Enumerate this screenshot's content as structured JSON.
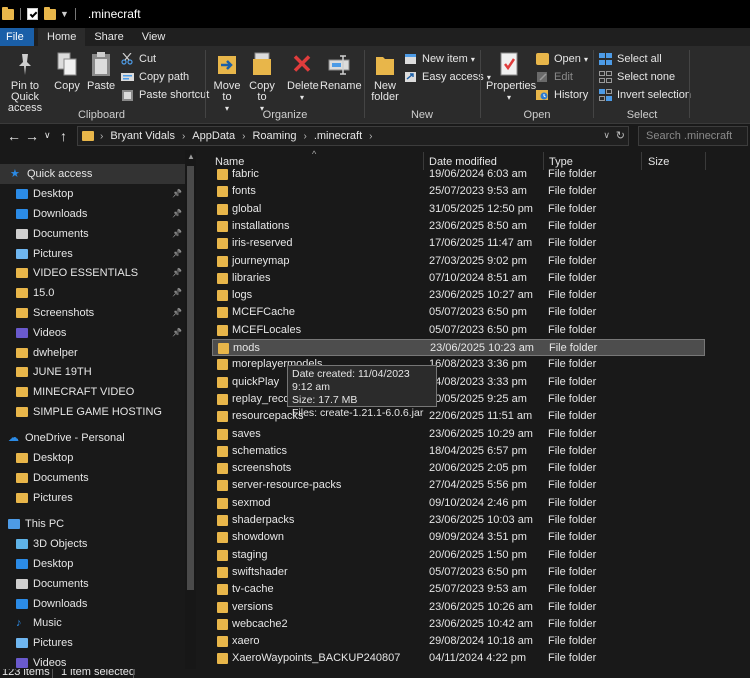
{
  "titlebar": {
    "title": ".minecraft"
  },
  "tabs": [
    {
      "label": "File"
    },
    {
      "label": "Home"
    },
    {
      "label": "Share"
    },
    {
      "label": "View"
    }
  ],
  "ribbon": {
    "clipboard": {
      "label": "Clipboard",
      "pin": "Pin to Quick access",
      "copy": "Copy",
      "paste": "Paste",
      "cut": "Cut",
      "copy_path": "Copy path",
      "paste_shortcut": "Paste shortcut"
    },
    "organize": {
      "label": "Organize",
      "move_to": "Move to",
      "copy_to": "Copy to",
      "delete": "Delete",
      "rename": "Rename"
    },
    "new": {
      "label": "New",
      "new_folder": "New folder",
      "new_item": "New item",
      "easy_access": "Easy access"
    },
    "open": {
      "label": "Open",
      "properties": "Properties",
      "open": "Open",
      "edit": "Edit",
      "history": "History"
    },
    "select": {
      "label": "Select",
      "select_all": "Select all",
      "select_none": "Select none",
      "invert": "Invert selection"
    }
  },
  "address": {
    "crumbs": [
      "Bryant Vidals",
      "AppData",
      "Roaming",
      ".minecraft"
    ],
    "search_placeholder": "Search .minecraft"
  },
  "sidebar": {
    "items": [
      {
        "label": "Quick access",
        "icon": "star-icon",
        "pinned": false
      },
      {
        "label": "Desktop",
        "icon": "desktop-icon",
        "pinned": true
      },
      {
        "label": "Downloads",
        "icon": "download-icon",
        "pinned": true
      },
      {
        "label": "Documents",
        "icon": "documents-icon",
        "pinned": true
      },
      {
        "label": "Pictures",
        "icon": "pictures-icon",
        "pinned": true
      },
      {
        "label": "VIDEO ESSENTIALS",
        "icon": "folder-icon",
        "pinned": true
      },
      {
        "label": "15.0",
        "icon": "folder-icon",
        "pinned": true
      },
      {
        "label": "Screenshots",
        "icon": "folder-icon",
        "pinned": true
      },
      {
        "label": "Videos",
        "icon": "videos-icon",
        "pinned": true
      },
      {
        "label": "dwhelper",
        "icon": "folder-icon",
        "pinned": false
      },
      {
        "label": "JUNE 19TH",
        "icon": "folder-icon",
        "pinned": false
      },
      {
        "label": "MINECRAFT VIDEO",
        "icon": "folder-icon",
        "pinned": false
      },
      {
        "label": "SIMPLE GAME HOSTING",
        "icon": "folder-icon",
        "pinned": false
      },
      {
        "label": "OneDrive - Personal",
        "icon": "cloud-icon",
        "pinned": false
      },
      {
        "label": "Desktop",
        "icon": "folder-icon",
        "pinned": false
      },
      {
        "label": "Documents",
        "icon": "folder-icon",
        "pinned": false
      },
      {
        "label": "Pictures",
        "icon": "folder-icon",
        "pinned": false
      },
      {
        "label": "This PC",
        "icon": "computer-icon",
        "pinned": false
      },
      {
        "label": "3D Objects",
        "icon": "3d-objects-icon",
        "pinned": false
      },
      {
        "label": "Desktop",
        "icon": "desktop-icon",
        "pinned": false
      },
      {
        "label": "Documents",
        "icon": "documents-icon",
        "pinned": false
      },
      {
        "label": "Downloads",
        "icon": "download-icon",
        "pinned": false
      },
      {
        "label": "Music",
        "icon": "music-icon",
        "pinned": false
      },
      {
        "label": "Pictures",
        "icon": "pictures-icon",
        "pinned": false
      },
      {
        "label": "Videos",
        "icon": "videos-icon",
        "pinned": false
      }
    ]
  },
  "columns": {
    "name": "Name",
    "date": "Date modified",
    "type": "Type",
    "size": "Size"
  },
  "files": [
    {
      "name": "fabric",
      "date": "19/06/2024 6:03 am",
      "type": "File folder"
    },
    {
      "name": "fonts",
      "date": "25/07/2023 9:53 am",
      "type": "File folder"
    },
    {
      "name": "global",
      "date": "31/05/2025 12:50 pm",
      "type": "File folder"
    },
    {
      "name": "installations",
      "date": "23/06/2025 8:50 am",
      "type": "File folder"
    },
    {
      "name": "iris-reserved",
      "date": "17/06/2025 11:47 am",
      "type": "File folder"
    },
    {
      "name": "journeymap",
      "date": "27/03/2025 9:02 pm",
      "type": "File folder"
    },
    {
      "name": "libraries",
      "date": "07/10/2024 8:51 am",
      "type": "File folder"
    },
    {
      "name": "logs",
      "date": "23/06/2025 10:27 am",
      "type": "File folder"
    },
    {
      "name": "MCEFCache",
      "date": "05/07/2023 6:50 pm",
      "type": "File folder"
    },
    {
      "name": "MCEFLocales",
      "date": "05/07/2023 6:50 pm",
      "type": "File folder"
    },
    {
      "name": "mods",
      "date": "23/06/2025 10:23 am",
      "type": "File folder"
    },
    {
      "name": "moreplayermodels",
      "date": "16/08/2023 3:36 pm",
      "type": "File folder"
    },
    {
      "name": "quickPlay",
      "date": "14/08/2023 3:33 pm",
      "type": "File folder"
    },
    {
      "name": "replay_recordings",
      "date": "10/05/2025 9:25 am",
      "type": "File folder"
    },
    {
      "name": "resourcepacks",
      "date": "22/06/2025 11:51 am",
      "type": "File folder"
    },
    {
      "name": "saves",
      "date": "23/06/2025 10:29 am",
      "type": "File folder"
    },
    {
      "name": "schematics",
      "date": "18/04/2025 6:57 pm",
      "type": "File folder"
    },
    {
      "name": "screenshots",
      "date": "20/06/2025 2:05 pm",
      "type": "File folder"
    },
    {
      "name": "server-resource-packs",
      "date": "27/04/2025 5:56 pm",
      "type": "File folder"
    },
    {
      "name": "sexmod",
      "date": "09/10/2024 2:46 pm",
      "type": "File folder"
    },
    {
      "name": "shaderpacks",
      "date": "23/06/2025 10:03 am",
      "type": "File folder"
    },
    {
      "name": "showdown",
      "date": "09/09/2024 3:51 pm",
      "type": "File folder"
    },
    {
      "name": "staging",
      "date": "20/06/2025 1:50 pm",
      "type": "File folder"
    },
    {
      "name": "swiftshader",
      "date": "05/07/2023 6:50 pm",
      "type": "File folder"
    },
    {
      "name": "tv-cache",
      "date": "25/07/2023 9:53 am",
      "type": "File folder"
    },
    {
      "name": "versions",
      "date": "23/06/2025 10:26 am",
      "type": "File folder"
    },
    {
      "name": "webcache2",
      "date": "23/06/2025 10:42 am",
      "type": "File folder"
    },
    {
      "name": "xaero",
      "date": "29/08/2024 10:18 am",
      "type": "File folder"
    },
    {
      "name": "XaeroWaypoints_BACKUP240807",
      "date": "04/11/2024 4:22 pm",
      "type": "File folder"
    }
  ],
  "selected_index": 10,
  "tooltip": {
    "line1": "Date created: 11/04/2023 9:12 am",
    "line2": "Size: 17.7 MB",
    "line3": "Files: create-1.21.1-6.0.6.jar"
  },
  "status": {
    "count": "123 items",
    "selected": "1 item selected"
  },
  "colors": {
    "accent": "#1a5fa8",
    "folder": "#e8b64a",
    "background": "#191919",
    "selection": "#4d4d4d"
  }
}
